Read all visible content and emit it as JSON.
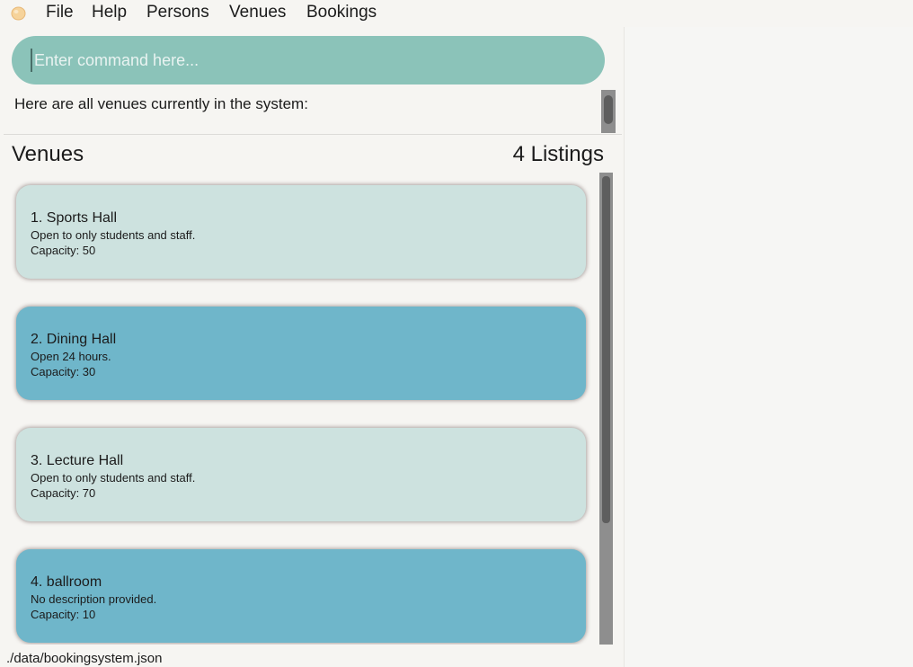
{
  "menu": {
    "app_icon": "egg-icon",
    "items": [
      "File",
      "Help",
      "Persons",
      "Venues",
      "Bookings"
    ]
  },
  "command": {
    "placeholder": "Enter command here...",
    "value": ""
  },
  "result": {
    "text": "Here are all venues currently in the system:"
  },
  "list": {
    "title": "Venues",
    "count": "4 Listings",
    "venues": [
      {
        "name": "1.  Sports Hall",
        "description": "Open to only students and staff.",
        "capacity": "Capacity: 50"
      },
      {
        "name": "2.  Dining Hall",
        "description": "Open 24 hours.",
        "capacity": "Capacity: 30"
      },
      {
        "name": "3.  Lecture Hall",
        "description": "Open to only students and staff.",
        "capacity": "Capacity: 70"
      },
      {
        "name": "4.  ballroom",
        "description": "No description provided.",
        "capacity": "Capacity: 10"
      }
    ]
  },
  "status": {
    "file_path": "./data/bookingsystem.json"
  },
  "colors": {
    "command_box": "#8bc3b9",
    "card_light": "#cde2df",
    "card_dark": "#6fb6ca",
    "background": "#f6f5f2"
  }
}
